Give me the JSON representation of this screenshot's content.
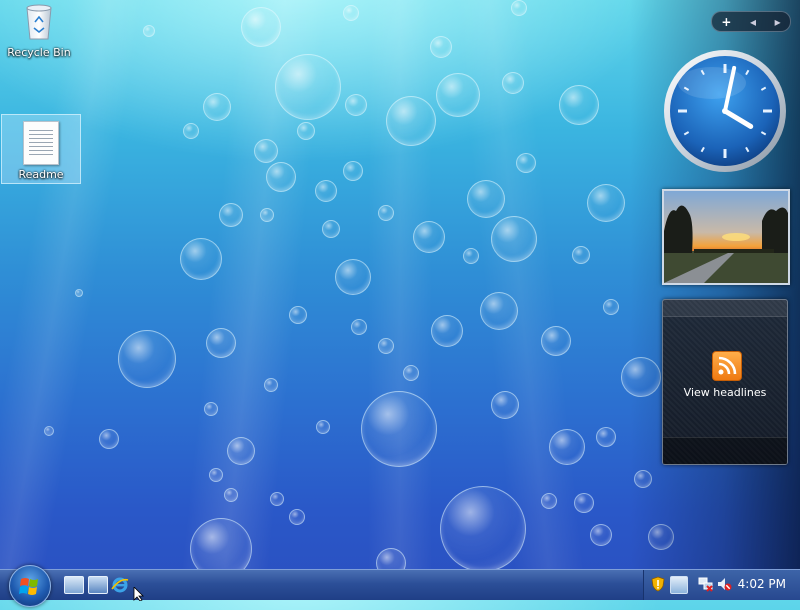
{
  "desktop": {
    "icons": [
      {
        "label": "Recycle Bin",
        "icon": "recycle-bin-icon"
      },
      {
        "label": "Readme",
        "icon": "text-document-icon",
        "selected": true
      }
    ]
  },
  "sidebar": {
    "toolbar": {
      "add": "+",
      "prev": "◂",
      "next": "▸"
    },
    "clock": {
      "hour": 4,
      "minute": 2
    },
    "slideshow": {
      "image": "sunset-road-photo"
    },
    "feeds": {
      "label": "View headlines",
      "icon": "rss-icon"
    }
  },
  "taskbar": {
    "start": {
      "icon": "windows-logo-icon"
    },
    "quick_launch": [
      "show-desktop-icon",
      "switch-windows-icon",
      "internet-explorer-icon"
    ],
    "tray_icons": [
      "security-shield-icon",
      "network-icon",
      "network-status-icon",
      "volume-muted-icon"
    ],
    "time": "4:02 PM"
  },
  "colors": {
    "taskbar": "#2c4f98",
    "accent": "#1f5bb0",
    "rss": "#ef7a12"
  }
}
